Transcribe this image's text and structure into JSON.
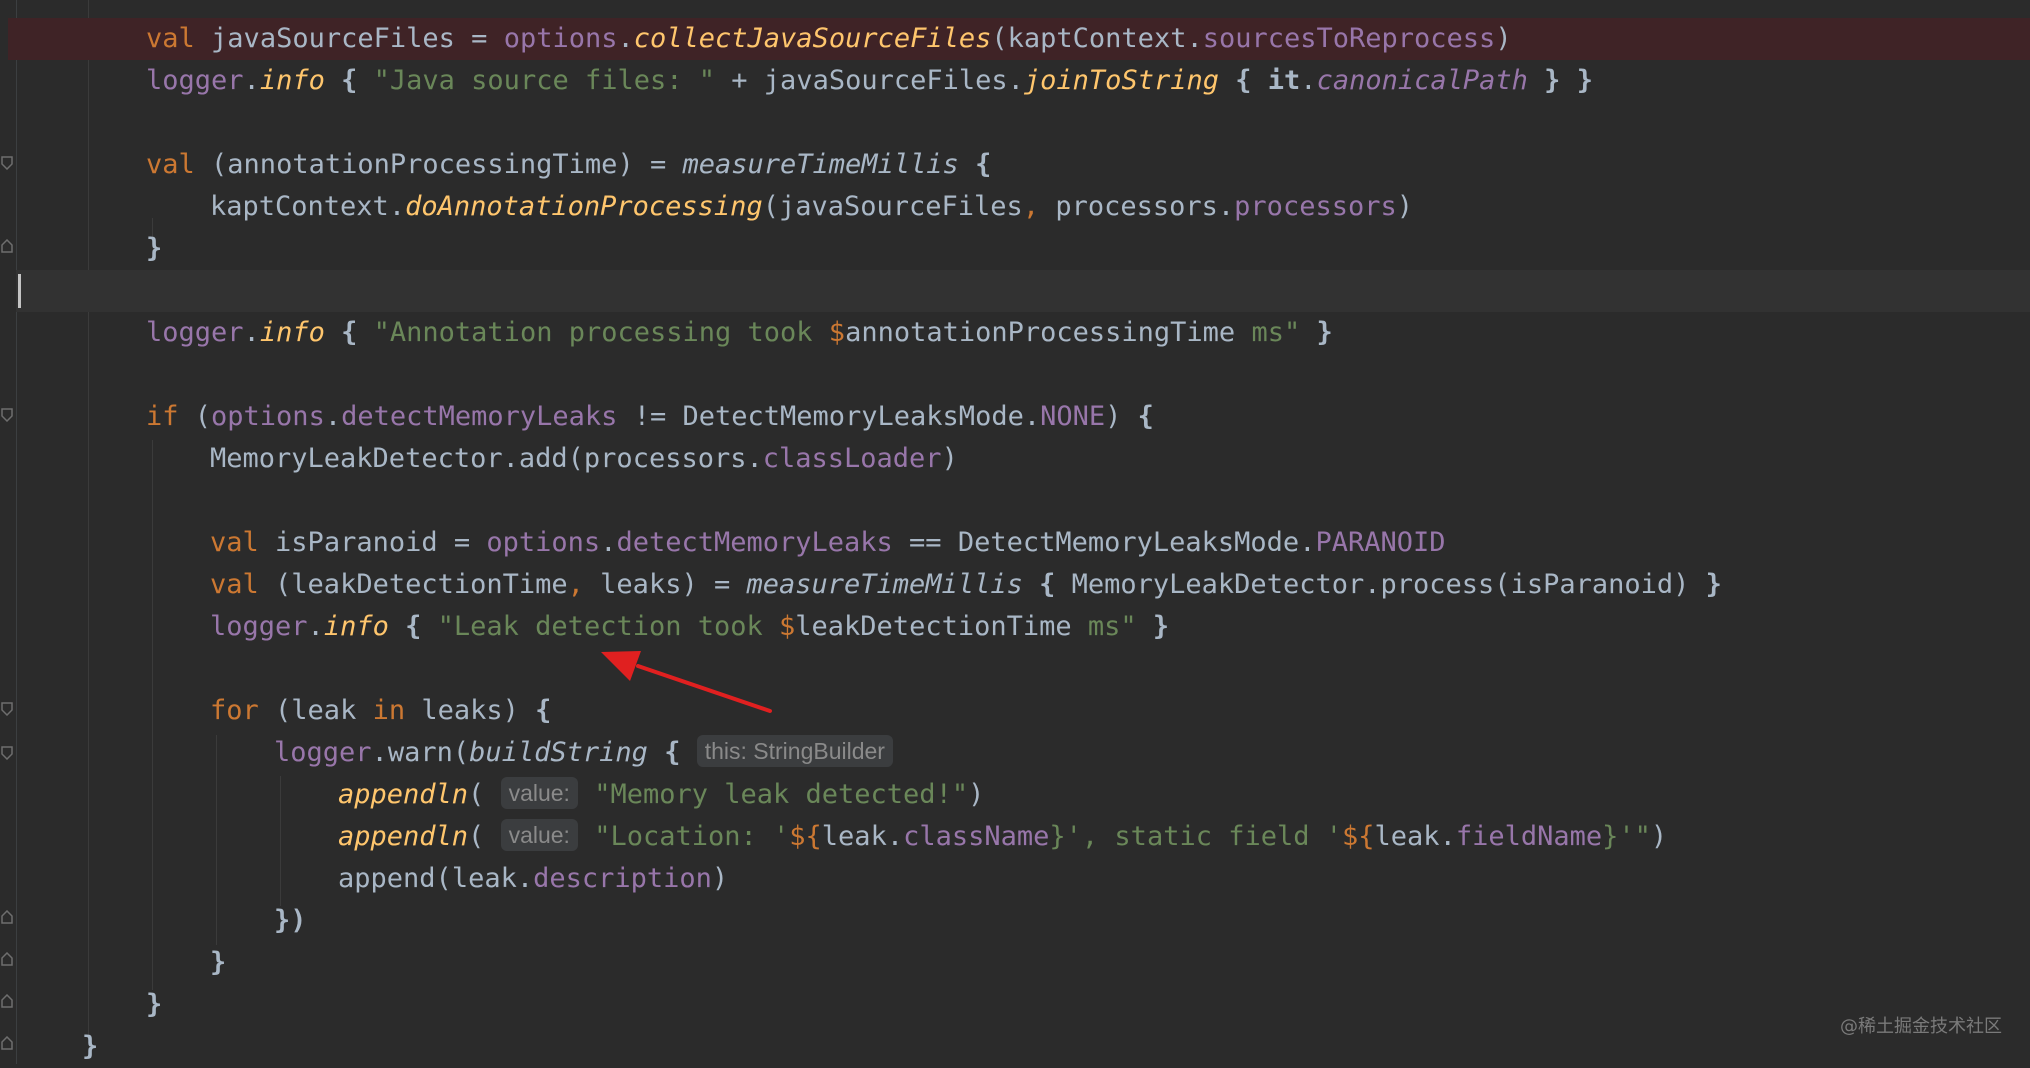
{
  "code_lines": [
    [
      "val",
      "javaSourceFiles",
      "=",
      "options",
      "collectJavaSourceFiles",
      "kaptContext",
      "sourcesToReprocess"
    ],
    [
      "logger",
      "info",
      "\"Java source files: \"",
      "javaSourceFiles",
      "joinToString",
      "it",
      "canonicalPath"
    ],
    [
      "val",
      "annotationProcessingTime",
      "measureTimeMillis"
    ],
    [
      "kaptContext",
      "doAnnotationProcessing",
      "javaSourceFiles",
      "processors",
      "processors"
    ],
    [
      "logger",
      "info",
      "\"Annotation processing took ",
      "$",
      "annotationProcessingTime",
      " ms\""
    ],
    [
      "if",
      "options",
      "detectMemoryLeaks",
      "DetectMemoryLeaksMode",
      "NONE"
    ],
    [
      "MemoryLeakDetector",
      "add",
      "processors",
      "classLoader"
    ],
    [
      "val",
      "isParanoid",
      "options",
      "detectMemoryLeaks",
      "DetectMemoryLeaksMode",
      "PARANOID"
    ],
    [
      "val",
      "leakDetectionTime",
      "leaks",
      "measureTimeMillis",
      "MemoryLeakDetector",
      "process",
      "isParanoid"
    ],
    [
      "logger",
      "info",
      "\"Leak detection took ",
      "$",
      "leakDetectionTime",
      " ms\""
    ],
    [
      "for",
      "leak",
      "in",
      "leaks"
    ],
    [
      "logger",
      "warn",
      "buildString",
      "this: StringBuilder"
    ],
    [
      "appendln",
      "value:",
      "\"Memory leak detected!\""
    ],
    [
      "appendln",
      "value:",
      "\"Location: '",
      "${",
      "leak",
      "className",
      "}', static field '",
      "${",
      "leak",
      "fieldName",
      "}'\""
    ],
    [
      "append",
      "leak",
      "description"
    ]
  ],
  "colors": {
    "background": "#2b2b2b",
    "keyword": "#cc7832",
    "property": "#9876aa",
    "function": "#ffc66d",
    "string": "#6a8759",
    "text": "#a9b7c6",
    "error_line": "#3f2326",
    "arrow": "#e02020"
  },
  "icons": [
    "fold-marker-icon",
    "arrow-annotation-icon"
  ],
  "watermark": "@稀土掘金技术社区"
}
